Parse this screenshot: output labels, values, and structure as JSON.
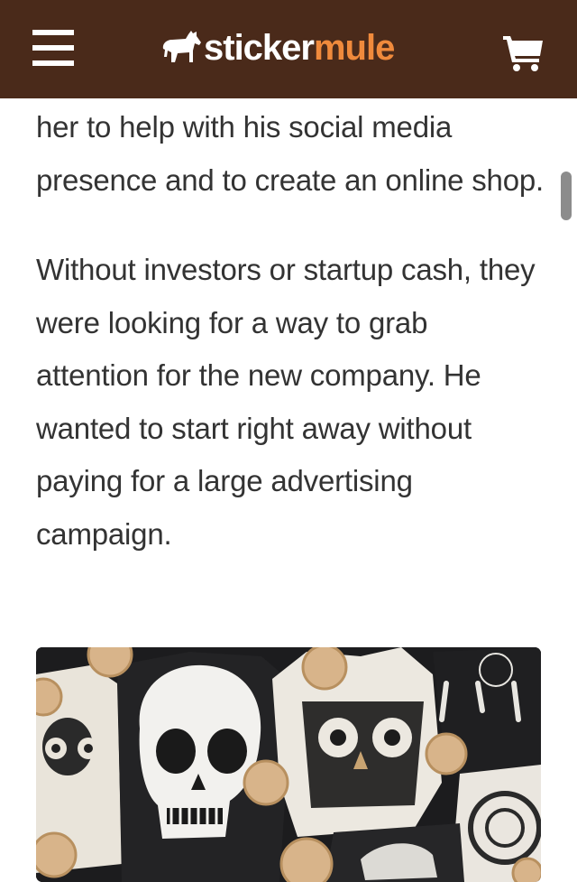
{
  "header": {
    "brand_part1": "sticker",
    "brand_part2": "mule",
    "menu_icon": "hamburger-menu-icon",
    "cart_icon": "shopping-cart-icon",
    "colors": {
      "bar": "#4a2a1a",
      "brand_accent": "#f08a3c",
      "icon": "#ffffff"
    }
  },
  "article": {
    "paragraphs": [
      "her to help with his social media presence and to create an online shop.",
      "Without investors or startup cash, they were looking for a way to grab attention for the new company. He wanted to start right away without paying for a large advertising campaign."
    ],
    "image": {
      "subject": "printed t-shirts with skull and owl designs and round wooden badges"
    }
  },
  "colors": {
    "text": "#333333",
    "background": "#ffffff"
  }
}
